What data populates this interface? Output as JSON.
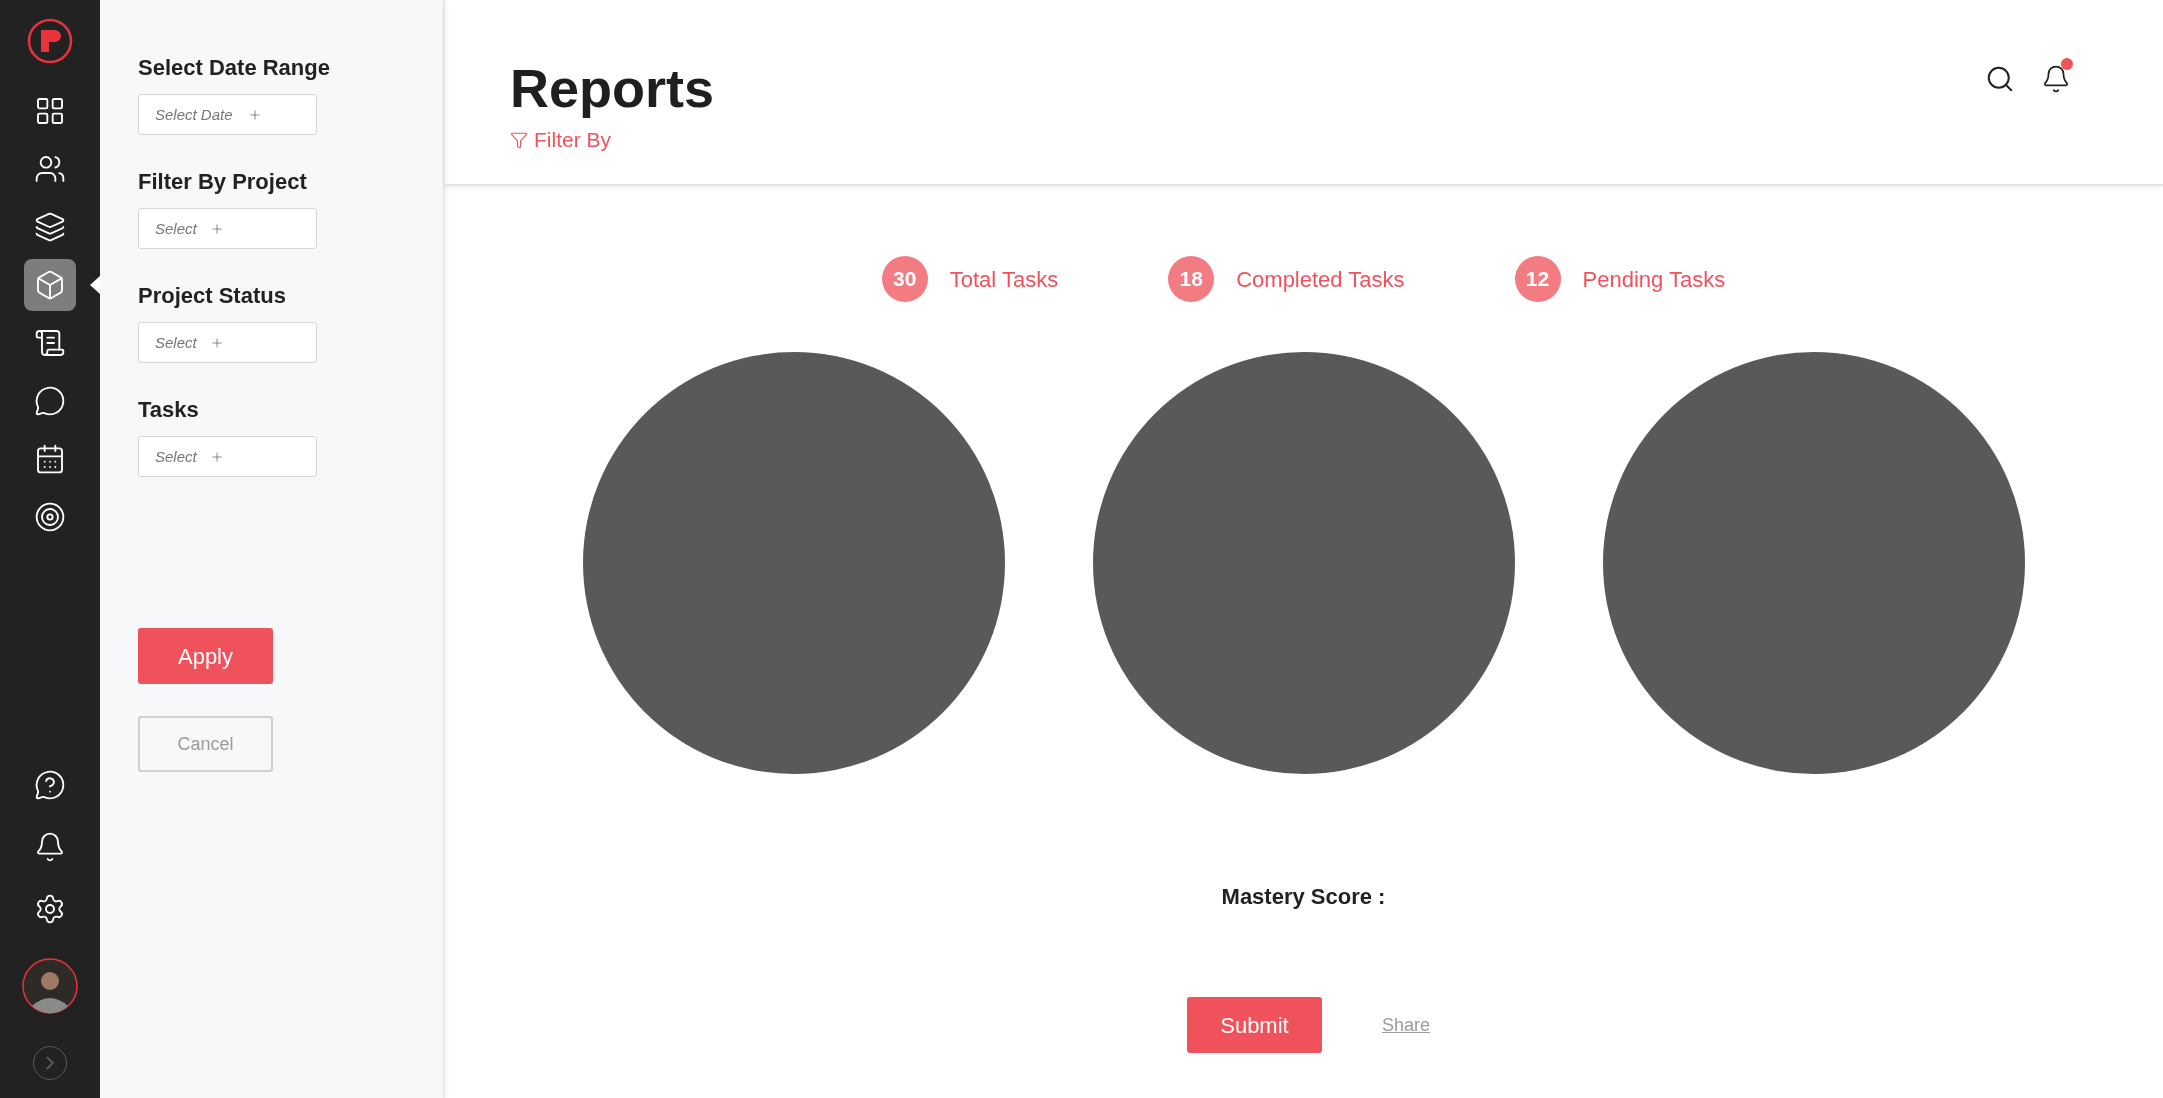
{
  "nav": {
    "items": [
      {
        "kind": "grid",
        "selected": false
      },
      {
        "kind": "team",
        "selected": false
      },
      {
        "kind": "layers",
        "selected": false
      },
      {
        "kind": "cube",
        "selected": true
      },
      {
        "kind": "invoice",
        "selected": false
      },
      {
        "kind": "chat",
        "selected": false
      },
      {
        "kind": "calendar",
        "selected": false
      },
      {
        "kind": "target",
        "selected": false
      }
    ],
    "bottom": [
      {
        "kind": "help"
      },
      {
        "kind": "bell"
      },
      {
        "kind": "settings"
      }
    ]
  },
  "filters": {
    "sections": [
      {
        "label": "Select Date Range",
        "placeholder": "Select Date"
      },
      {
        "label": "Filter By Project",
        "placeholder": "Select"
      },
      {
        "label": "Project Status",
        "placeholder": "Select"
      },
      {
        "label": "Tasks",
        "placeholder": "Select"
      }
    ],
    "apply": "Apply",
    "cancel": "Cancel"
  },
  "header": {
    "title": "Reports",
    "filter_link": "Filter By",
    "notification_dot": true
  },
  "stats": [
    {
      "count": "30",
      "label": "Total Tasks"
    },
    {
      "count": "18",
      "label": "Completed Tasks"
    },
    {
      "count": "12",
      "label": "Pending Tasks"
    }
  ],
  "mastery_label": "Mastery Score :",
  "submit": "Submit",
  "share": "Share"
}
